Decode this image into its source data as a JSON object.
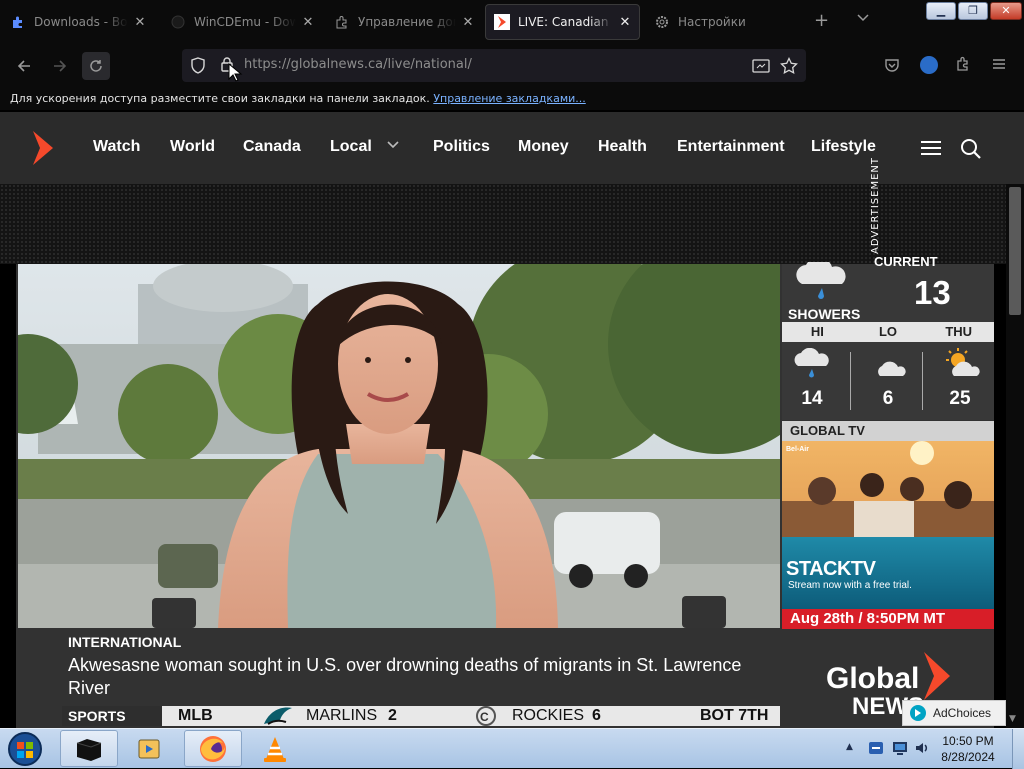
{
  "browser": {
    "tabs": [
      {
        "title": "Downloads - Bob P",
        "icon": "puzzle-icon",
        "active": false
      },
      {
        "title": "WinCDEmu - Down",
        "icon": "globe-icon",
        "active": false
      },
      {
        "title": "Управление допо",
        "icon": "puzzle-icon",
        "active": false
      },
      {
        "title": "LIVE: Canadian New",
        "icon": "globalnews-favicon",
        "active": true
      },
      {
        "title": "Настройки",
        "icon": "gear-icon",
        "active": false
      }
    ],
    "url_host": "https://globalnews.ca",
    "url_path": "/live/national/",
    "bookmark_hint": "Для ускорения доступа разместите свои закладки на панели закладок.",
    "bookmark_link": "Управление закладками...",
    "accent_color": "#7ab2ff"
  },
  "site": {
    "brand_color": "#f5492b",
    "nav": [
      "Watch",
      "World",
      "Canada",
      "Local",
      "Politics",
      "Money",
      "Health",
      "Entertainment",
      "Lifestyle"
    ],
    "ad_label": "ADVERTISEMENT"
  },
  "player": {
    "weather": {
      "title": "CURRENT",
      "condition": "SHOWERS",
      "temp": "13",
      "forecast_headers": [
        "HI",
        "LO",
        "THU"
      ],
      "forecast": [
        {
          "value": "14",
          "icon": "rain-cloud-icon"
        },
        {
          "value": "6",
          "icon": "moon-cloud-icon"
        },
        {
          "value": "25",
          "icon": "sun-cloud-icon"
        }
      ]
    },
    "promo": {
      "bar": "GLOBAL TV",
      "show": "Bel-Air",
      "brand": "STACKTV",
      "tagline": "Stream now with a free trial.",
      "date": "Aug 28th / 8:50PM MT"
    },
    "story": {
      "kicker": "INTERNATIONAL",
      "headline": "Akwesasne woman sought in U.S. over drowning deaths of migrants in St. Lawrence River"
    },
    "ticker": {
      "section": "SPORTS",
      "league": "MLB",
      "away_team": "MARLINS",
      "away_score": "2",
      "home_team": "ROCKIES",
      "home_score": "6",
      "status": "BOT 7TH"
    },
    "bug_line1": "Global",
    "bug_line2": "NEWS",
    "adchoices": "AdChoices"
  },
  "taskbar": {
    "time": "10:50 PM",
    "date": "8/28/2024"
  }
}
